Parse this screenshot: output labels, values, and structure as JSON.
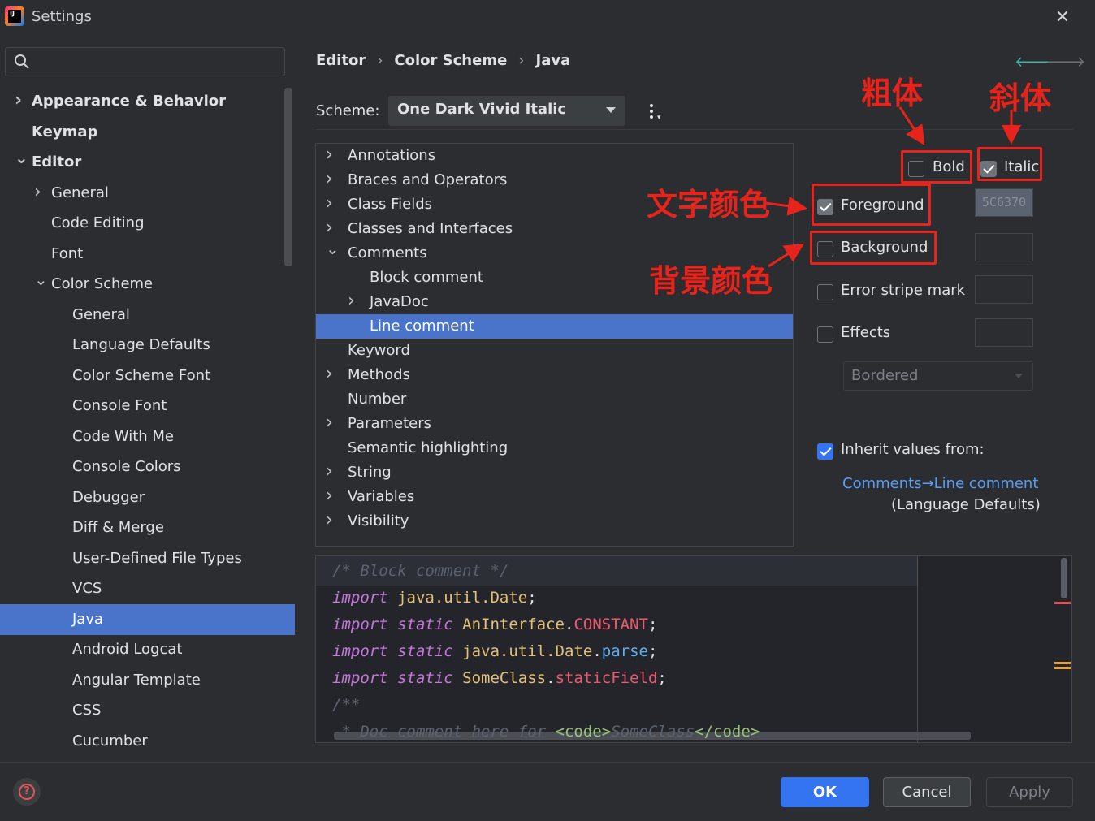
{
  "window": {
    "title": "Settings"
  },
  "sidebar": {
    "items": [
      {
        "label": "Appearance & Behavior",
        "level": 0,
        "bold": true,
        "expander": "collapsed"
      },
      {
        "label": "Keymap",
        "level": 0,
        "bold": true,
        "expander": "none"
      },
      {
        "label": "Editor",
        "level": 0,
        "bold": true,
        "expander": "expanded"
      },
      {
        "label": "General",
        "level": 1,
        "bold": false,
        "expander": "collapsed"
      },
      {
        "label": "Code Editing",
        "level": 1,
        "bold": false,
        "expander": "none"
      },
      {
        "label": "Font",
        "level": 1,
        "bold": false,
        "expander": "none"
      },
      {
        "label": "Color Scheme",
        "level": 1,
        "bold": false,
        "expander": "expanded"
      },
      {
        "label": "General",
        "level": 2,
        "bold": false,
        "expander": "none"
      },
      {
        "label": "Language Defaults",
        "level": 2,
        "bold": false,
        "expander": "none"
      },
      {
        "label": "Color Scheme Font",
        "level": 2,
        "bold": false,
        "expander": "none"
      },
      {
        "label": "Console Font",
        "level": 2,
        "bold": false,
        "expander": "none"
      },
      {
        "label": "Code With Me",
        "level": 2,
        "bold": false,
        "expander": "none"
      },
      {
        "label": "Console Colors",
        "level": 2,
        "bold": false,
        "expander": "none"
      },
      {
        "label": "Debugger",
        "level": 2,
        "bold": false,
        "expander": "none"
      },
      {
        "label": "Diff & Merge",
        "level": 2,
        "bold": false,
        "expander": "none"
      },
      {
        "label": "User-Defined File Types",
        "level": 2,
        "bold": false,
        "expander": "none"
      },
      {
        "label": "VCS",
        "level": 2,
        "bold": false,
        "expander": "none"
      },
      {
        "label": "Java",
        "level": 2,
        "bold": false,
        "expander": "none",
        "selected": true
      },
      {
        "label": "Android Logcat",
        "level": 2,
        "bold": false,
        "expander": "none"
      },
      {
        "label": "Angular Template",
        "level": 2,
        "bold": false,
        "expander": "none"
      },
      {
        "label": "CSS",
        "level": 2,
        "bold": false,
        "expander": "none"
      },
      {
        "label": "Cucumber",
        "level": 2,
        "bold": false,
        "expander": "none"
      }
    ]
  },
  "breadcrumb": {
    "items": [
      "Editor",
      "Color Scheme",
      "Java"
    ],
    "separator": "›"
  },
  "nav": {
    "back_icon": "arrow-left-icon",
    "forward_icon": "arrow-right-icon"
  },
  "scheme": {
    "label": "Scheme:",
    "value": "One Dark Vivid Italic"
  },
  "tree": {
    "items": [
      {
        "label": "Annotations",
        "level": 0,
        "expander": "collapsed"
      },
      {
        "label": "Braces and Operators",
        "level": 0,
        "expander": "collapsed"
      },
      {
        "label": "Class Fields",
        "level": 0,
        "expander": "collapsed"
      },
      {
        "label": "Classes and Interfaces",
        "level": 0,
        "expander": "collapsed"
      },
      {
        "label": "Comments",
        "level": 0,
        "expander": "expanded"
      },
      {
        "label": "Block comment",
        "level": 1,
        "expander": "none"
      },
      {
        "label": "JavaDoc",
        "level": 1,
        "expander": "collapsed"
      },
      {
        "label": "Line comment",
        "level": 1,
        "expander": "none",
        "selected": true
      },
      {
        "label": "Keyword",
        "level": 0,
        "expander": "none"
      },
      {
        "label": "Methods",
        "level": 0,
        "expander": "collapsed"
      },
      {
        "label": "Number",
        "level": 0,
        "expander": "none"
      },
      {
        "label": "Parameters",
        "level": 0,
        "expander": "collapsed"
      },
      {
        "label": "Semantic highlighting",
        "level": 0,
        "expander": "none"
      },
      {
        "label": "String",
        "level": 0,
        "expander": "collapsed"
      },
      {
        "label": "Variables",
        "level": 0,
        "expander": "collapsed"
      },
      {
        "label": "Visibility",
        "level": 0,
        "expander": "collapsed"
      }
    ]
  },
  "attributes": {
    "bold": {
      "label": "Bold",
      "checked": false
    },
    "italic": {
      "label": "Italic",
      "checked": true
    },
    "foreground": {
      "label": "Foreground",
      "checked": true,
      "color": "5C6370"
    },
    "background": {
      "label": "Background",
      "checked": false
    },
    "error_stripe": {
      "label": "Error stripe mark",
      "checked": false
    },
    "effects": {
      "label": "Effects",
      "checked": false,
      "type": "Bordered"
    },
    "inherit": {
      "label": "Inherit values from:",
      "checked": true,
      "link": "Comments→Line comment",
      "source": "(Language Defaults)"
    }
  },
  "annotations": {
    "bold": "粗体",
    "italic": "斜体",
    "foreground": "文字颜色",
    "background": "背景颜色"
  },
  "preview": {
    "lines": [
      [
        {
          "t": "/* Block comment */",
          "c": "comment"
        }
      ],
      [
        {
          "t": "import",
          "c": "kw"
        },
        {
          "t": " java.util.Date",
          "c": "type"
        },
        {
          "t": ";",
          "c": "plain"
        }
      ],
      [
        {
          "t": "import static",
          "c": "kw"
        },
        {
          "t": " AnInterface",
          "c": "type"
        },
        {
          "t": ".",
          "c": "plain"
        },
        {
          "t": "CONSTANT",
          "c": "const"
        },
        {
          "t": ";",
          "c": "plain"
        }
      ],
      [
        {
          "t": "import static",
          "c": "kw"
        },
        {
          "t": " java.util.Date",
          "c": "type"
        },
        {
          "t": ".",
          "c": "plain"
        },
        {
          "t": "parse",
          "c": "fn"
        },
        {
          "t": ";",
          "c": "plain"
        }
      ],
      [
        {
          "t": "import static",
          "c": "kw"
        },
        {
          "t": " SomeClass",
          "c": "type"
        },
        {
          "t": ".",
          "c": "plain"
        },
        {
          "t": "staticField",
          "c": "field"
        },
        {
          "t": ";",
          "c": "plain"
        }
      ],
      [
        {
          "t": "/**",
          "c": "comment"
        }
      ],
      [
        {
          "t": " * Doc comment here for ",
          "c": "comment"
        },
        {
          "t": "<code>",
          "c": "tag"
        },
        {
          "t": "SomeClass",
          "c": "comment"
        },
        {
          "t": "</code>",
          "c": "tag"
        }
      ]
    ],
    "colors": {
      "comment": "#5c6370",
      "keyword": "#c678dd",
      "type": "#e5c07b",
      "constant": "#ef596f",
      "function": "#61afef",
      "tag": "#98c379"
    }
  },
  "footer": {
    "help_icon": "help-icon",
    "ok": "OK",
    "cancel": "Cancel",
    "apply": "Apply"
  },
  "colors": {
    "accent": "#3574f0",
    "selection": "#4a74c9",
    "annotation": "#e8231c",
    "link": "#589df6"
  }
}
